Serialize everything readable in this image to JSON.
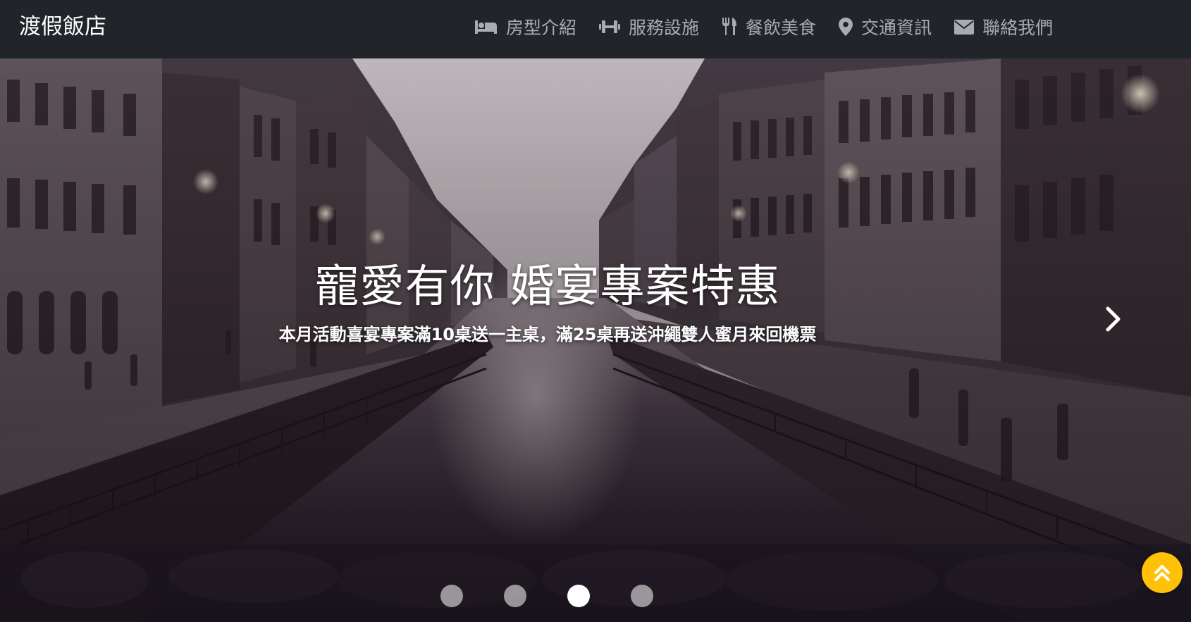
{
  "navbar": {
    "brand": "渡假飯店",
    "items": [
      {
        "label": "房型介紹",
        "icon": "bed-icon"
      },
      {
        "label": "服務設施",
        "icon": "dumbbell-icon"
      },
      {
        "label": "餐飲美食",
        "icon": "utensils-icon"
      },
      {
        "label": "交通資訊",
        "icon": "map-marker-icon"
      },
      {
        "label": "聯絡我們",
        "icon": "envelope-icon"
      }
    ]
  },
  "carousel": {
    "title": "寵愛有你 婚宴專案特惠",
    "subtitle": "本月活動喜宴專案滿10桌送一主桌，滿25桌再送沖繩雙人蜜月來回機票",
    "active_slide": 3,
    "slide_count": 4
  },
  "colors": {
    "navbar_bg": "#212529",
    "nav_text": "#a8abaf",
    "brand_text": "#ffffff",
    "back_to_top": "#ffc107"
  }
}
